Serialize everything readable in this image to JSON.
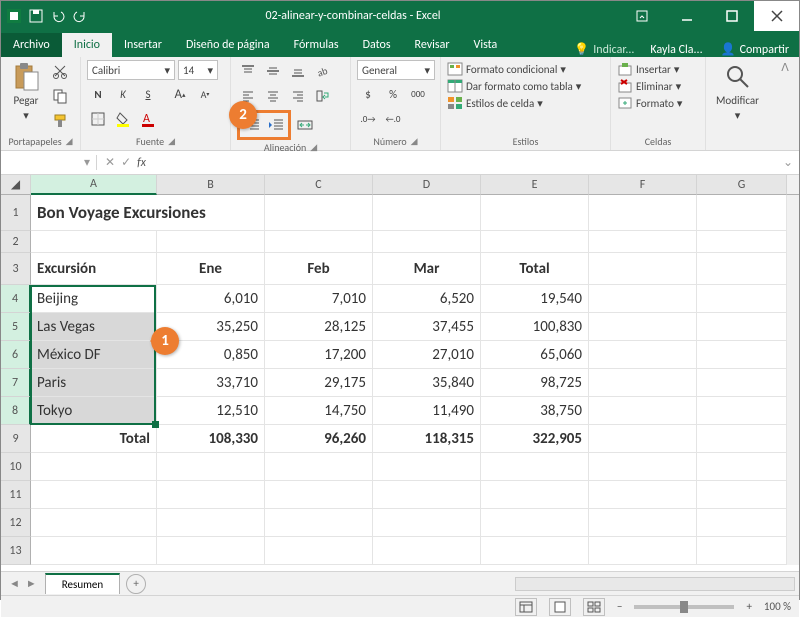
{
  "title": "02-alinear-y-combinar-celdas - Excel",
  "menu": {
    "file": "Archivo",
    "home": "Inicio",
    "insert": "Insertar",
    "page": "Diseño de página",
    "formulas": "Fórmulas",
    "data": "Datos",
    "review": "Revisar",
    "view": "Vista",
    "tell": "Indicar...",
    "user": "Kayla Cla...",
    "share": "Compartir"
  },
  "ribbon": {
    "clipboard": {
      "label": "Portapapeles",
      "paste": "Pegar"
    },
    "font": {
      "label": "Fuente",
      "name": "Calibri",
      "size": "14",
      "bold": "N",
      "italic": "K",
      "underline": "S"
    },
    "align": {
      "label": "Alineación"
    },
    "number": {
      "label": "Número",
      "format_name": "General"
    },
    "styles": {
      "label": "Estilos",
      "cond": "Formato condicional",
      "table": "Dar formato como tabla",
      "cell": "Estilos de celda"
    },
    "cells": {
      "label": "Celdas",
      "insert": "Insertar",
      "delete": "Eliminar",
      "format": "Formato"
    },
    "editing": {
      "modify": "Modificar"
    }
  },
  "formula": {
    "namebox": "",
    "fx": "fx"
  },
  "columns": [
    "A",
    "B",
    "C",
    "D",
    "E",
    "F",
    "G"
  ],
  "rows": [
    "1",
    "2",
    "3",
    "4",
    "5",
    "6",
    "7",
    "8",
    "9",
    "10",
    "11",
    "12",
    "13"
  ],
  "sheet": {
    "title": "Bon Voyage Excursiones",
    "headers": [
      "Excursión",
      "Ene",
      "Feb",
      "Mar",
      "Total"
    ],
    "data": [
      [
        "Beijing",
        "6,010",
        "7,010",
        "6,520",
        "19,540"
      ],
      [
        "Las Vegas",
        "35,250",
        "28,125",
        "37,455",
        "100,830"
      ],
      [
        "México DF",
        "0,850",
        "17,200",
        "27,010",
        "65,060"
      ],
      [
        "Paris",
        "33,710",
        "29,175",
        "35,840",
        "98,725"
      ],
      [
        "Tokyo",
        "12,510",
        "14,750",
        "11,490",
        "38,750"
      ]
    ],
    "total_label": "Total",
    "totals": [
      "108,330",
      "96,260",
      "118,315",
      "322,905"
    ]
  },
  "tabs": {
    "sheet1": "Resumen"
  },
  "status": {
    "zoom": "100 %"
  },
  "callouts": {
    "c1": "1",
    "c2": "2"
  },
  "chart_data": {
    "type": "table",
    "title": "Bon Voyage Excursiones",
    "columns": [
      "Excursión",
      "Ene",
      "Feb",
      "Mar",
      "Total"
    ],
    "rows": [
      {
        "Excursión": "Beijing",
        "Ene": 6010,
        "Feb": 7010,
        "Mar": 6520,
        "Total": 19540
      },
      {
        "Excursión": "Las Vegas",
        "Ene": 35250,
        "Feb": 28125,
        "Mar": 37455,
        "Total": 100830
      },
      {
        "Excursión": "México DF",
        "Ene": null,
        "Feb": 17200,
        "Mar": 27010,
        "Total": 65060
      },
      {
        "Excursión": "Paris",
        "Ene": 33710,
        "Feb": 29175,
        "Mar": 35840,
        "Total": 98725
      },
      {
        "Excursión": "Tokyo",
        "Ene": 12510,
        "Feb": 14750,
        "Mar": 11490,
        "Total": 38750
      },
      {
        "Excursión": "Total",
        "Ene": 108330,
        "Feb": 96260,
        "Mar": 118315,
        "Total": 322905
      }
    ]
  }
}
